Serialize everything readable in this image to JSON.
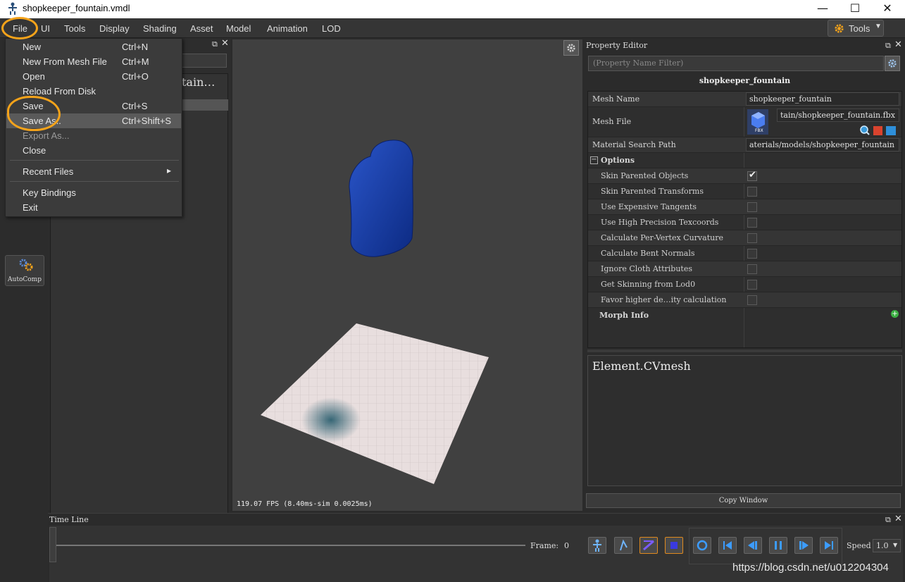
{
  "window": {
    "title": "shopkeeper_fountain.vmdl",
    "min": "—",
    "max": "☐",
    "close": "✕"
  },
  "menubar": {
    "items": [
      "File",
      "UI",
      "Tools",
      "Display",
      "Shading",
      "Asset",
      "Model",
      "Animation",
      "LOD"
    ],
    "tools_button": "Tools"
  },
  "file_menu": {
    "items": [
      {
        "label": "New",
        "shortcut": "Ctrl+N"
      },
      {
        "label": "New From Mesh File",
        "shortcut": "Ctrl+M"
      },
      {
        "label": "Open",
        "shortcut": "Ctrl+O"
      },
      {
        "label": "Reload From Disk",
        "shortcut": ""
      },
      {
        "label": "Save",
        "shortcut": "Ctrl+S"
      },
      {
        "label": "Save As..",
        "shortcut": "Ctrl+Shift+S"
      },
      {
        "label": "Export As...",
        "shortcut": ""
      },
      {
        "label": "Close",
        "shortcut": ""
      }
    ],
    "recent": "Recent Files",
    "recent_arrow": "▸",
    "key_bindings": "Key Bindings",
    "exit": "Exit"
  },
  "sidebar": {
    "autocomp_label": "AutoComp"
  },
  "outliner": {
    "header_fragment": "tain…"
  },
  "viewport": {
    "fps_text": "119.07 FPS (8.40ms-sim 0.0025ms)"
  },
  "property_editor": {
    "title": "Property Editor",
    "filter_placeholder": "(Property Name Filter)",
    "object_name": "shopkeeper_fountain",
    "mesh_name_label": "Mesh Name",
    "mesh_name_value": "shopkeeper_fountain",
    "mesh_file_label": "Mesh File",
    "mesh_file_value": "tain/shopkeeper_fountain.fbx",
    "fbx_tag": "FBX",
    "material_label": "Material Search Path",
    "material_value": "aterials/models/shopkeeper_fountain",
    "options_label": "Options",
    "options": [
      {
        "label": "Skin Parented Objects",
        "checked": true
      },
      {
        "label": "Skin Parented Transforms",
        "checked": false
      },
      {
        "label": "Use Expensive Tangents",
        "checked": false
      },
      {
        "label": "Use High Precision Texcoords",
        "checked": false
      },
      {
        "label": "Calculate Per-Vertex Curvature",
        "checked": false
      },
      {
        "label": "Calculate Bent Normals",
        "checked": false
      },
      {
        "label": "Ignore Cloth Attributes",
        "checked": false
      },
      {
        "label": "Get Skinning from Lod0",
        "checked": false
      },
      {
        "label": "Favor higher de…ity calculation",
        "checked": false
      }
    ],
    "morph_label": "Morph Info",
    "element_text": "Element.CVmesh",
    "copy_button": "Copy Window"
  },
  "timeline": {
    "title": "Time Line",
    "frame_label": "Frame:",
    "frame_value": "0",
    "speed_label": "Speed",
    "speed_value": "1.0"
  },
  "watermark": "https://blog.csdn.net/u012204304",
  "colors": {
    "accent_orange": "#f5a31a",
    "mesh_blue": "#1a3fa0",
    "plane": "#e6dede"
  }
}
